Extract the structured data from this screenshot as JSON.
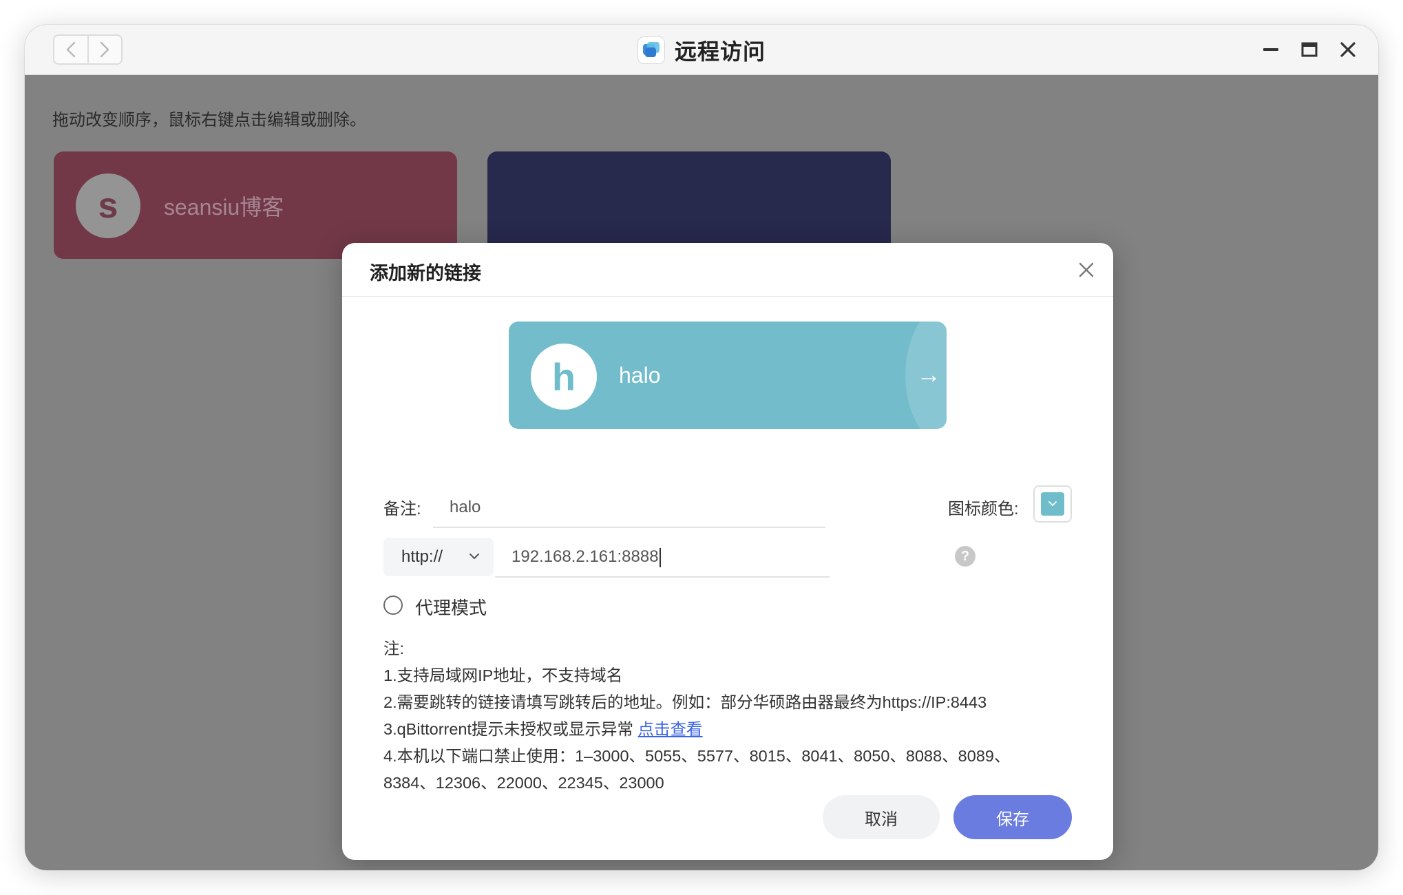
{
  "window": {
    "title": "远程访问"
  },
  "page": {
    "hint": "拖动改变顺序，鼠标右键点击编辑或删除。",
    "cards": [
      {
        "letter": "s",
        "title": "seansiu博客",
        "color": "#723848"
      },
      {
        "letter": "",
        "title": "",
        "color": "#27294d"
      }
    ]
  },
  "dialog": {
    "title": "添加新的链接",
    "preview": {
      "letter": "h",
      "title": "halo",
      "arrow": "→",
      "color": "#6fbccb"
    },
    "remark_label": "备注:",
    "remark_value": "halo",
    "icon_color_label": "图标颜色:",
    "icon_color": "#6fbccb",
    "protocol": "http://",
    "address": "192.168.2.161:8888",
    "help": "?",
    "proxy_label": "代理模式",
    "notes": {
      "title": "注:",
      "line1": "1.支持局域网IP地址，不支持域名",
      "line2": "2.需要跳转的链接请填写跳转后的地址。例如：部分华硕路由器最终为https://IP:8443",
      "line3": "3.qBittorrent提示未授权或显示异常",
      "line3_link": "点击查看",
      "line4": "4.本机以下端口禁止使用：1–3000、5055、5577、8015、8041、8050、8088、8089、",
      "line5": "8384、12306、22000、22345、23000"
    },
    "cancel_label": "取消",
    "save_label": "保存"
  }
}
